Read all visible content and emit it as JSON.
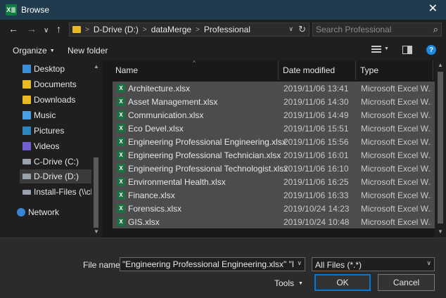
{
  "window": {
    "title": "Browse",
    "app_icon": "X≣",
    "close_glyph": "✕"
  },
  "nav": {
    "back_glyph": "←",
    "forward_glyph": "→",
    "recent_glyph": "∨",
    "up_glyph": "↑",
    "breadcrumb": [
      "D-Drive (D:)",
      "dataMerge",
      "Professional"
    ],
    "breadcrumb_sep": ">",
    "address_dropdown_glyph": "∨",
    "refresh_glyph": "↻",
    "search_placeholder": "Search Professional",
    "search_glyph": "⌕"
  },
  "toolbar": {
    "organize_label": "Organize",
    "new_folder_label": "New folder",
    "help_glyph": "?"
  },
  "sidebar": {
    "items": [
      {
        "label": "Desktop",
        "icon": "desktop-folder-icon"
      },
      {
        "label": "Documents",
        "icon": "documents-folder-icon"
      },
      {
        "label": "Downloads",
        "icon": "downloads-folder-icon"
      },
      {
        "label": "Music",
        "icon": "music-folder-icon"
      },
      {
        "label": "Pictures",
        "icon": "pictures-folder-icon"
      },
      {
        "label": "Videos",
        "icon": "videos-folder-icon"
      },
      {
        "label": "C-Drive (C:)",
        "icon": "drive-icon"
      },
      {
        "label": "D-Drive (D:)",
        "icon": "drive-icon",
        "selected": true
      },
      {
        "label": "Install-Files (\\\\cbe",
        "icon": "network-drive-icon"
      },
      {
        "label": "Network",
        "icon": "network-icon"
      }
    ]
  },
  "columns": {
    "name": "Name",
    "date": "Date modified",
    "type": "Type",
    "sort_glyph": "^"
  },
  "files": [
    {
      "name": "Architecture.xlsx",
      "date": "2019/11/06 13:41",
      "type": "Microsoft Excel W...",
      "selected": true
    },
    {
      "name": "Asset Management.xlsx",
      "date": "2019/11/06 14:30",
      "type": "Microsoft Excel W...",
      "selected": true
    },
    {
      "name": "Communication.xlsx",
      "date": "2019/11/06 14:49",
      "type": "Microsoft Excel W...",
      "selected": true
    },
    {
      "name": "Eco Devel.xlsx",
      "date": "2019/11/06 15:51",
      "type": "Microsoft Excel W...",
      "selected": true
    },
    {
      "name": "Engineering Professional Engineering.xlsx",
      "date": "2019/11/06 15:56",
      "type": "Microsoft Excel W...",
      "selected": true
    },
    {
      "name": "Engineering Professional Technician.xlsx",
      "date": "2019/11/06 16:01",
      "type": "Microsoft Excel W...",
      "selected": true
    },
    {
      "name": "Engineering Professional Technologist.xlsx",
      "date": "2019/11/06 16:10",
      "type": "Microsoft Excel W...",
      "selected": true
    },
    {
      "name": "Environmental Health.xlsx",
      "date": "2019/11/06 16:25",
      "type": "Microsoft Excel W...",
      "selected": true
    },
    {
      "name": "Finance.xlsx",
      "date": "2019/11/06 16:33",
      "type": "Microsoft Excel W...",
      "selected": true
    },
    {
      "name": "Forensics.xlsx",
      "date": "2019/10/24 14:23",
      "type": "Microsoft Excel W...",
      "selected": true
    },
    {
      "name": "GIS.xlsx",
      "date": "2019/10/24 10:48",
      "type": "Microsoft Excel W...",
      "selected": true
    }
  ],
  "file_icon_glyph": "X",
  "footer": {
    "file_name_label": "File name:",
    "file_name_value": "\"Engineering Professional Engineering.xlsx\" \"Engineering Professional Technician.xlsx\"",
    "filter_value": "All Files (*.*)",
    "dropdown_glyph": "∨",
    "tools_label": "Tools",
    "ok_label": "OK",
    "cancel_label": "Cancel"
  },
  "colors": {
    "titlebar": "#1f3b4d",
    "background": "#1f1f1f",
    "selection": "#4c4c4c",
    "accent": "#0078d7",
    "excel_green": "#1d6f42",
    "folder_yellow": "#e8b923"
  }
}
